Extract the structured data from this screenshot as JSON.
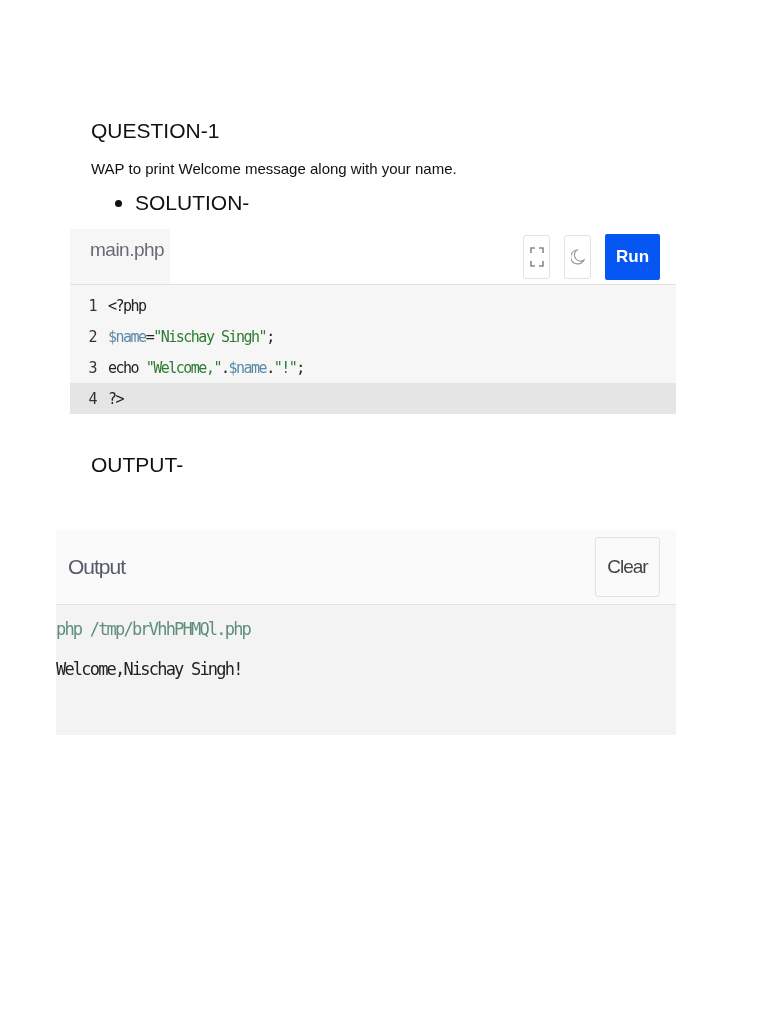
{
  "question": {
    "title": "QUESTION-1",
    "description": "WAP to print Welcome message along with your name."
  },
  "solution_label": "SOLUTION-",
  "editor": {
    "tab": "main.php",
    "run_button": "Run",
    "lines": [
      {
        "number": "1",
        "active": false,
        "tokens": [
          {
            "text": "<?php",
            "kind": "plain"
          }
        ]
      },
      {
        "number": "2",
        "active": false,
        "tokens": [
          {
            "text": "$name",
            "kind": "var"
          },
          {
            "text": "=",
            "kind": "plain"
          },
          {
            "text": "\"Nischay Singh\"",
            "kind": "string"
          },
          {
            "text": ";",
            "kind": "plain"
          }
        ]
      },
      {
        "number": "3",
        "active": false,
        "tokens": [
          {
            "text": "echo ",
            "kind": "plain"
          },
          {
            "text": "\"Welcome,\"",
            "kind": "string"
          },
          {
            "text": ".",
            "kind": "plain"
          },
          {
            "text": "$name",
            "kind": "var"
          },
          {
            "text": ".",
            "kind": "plain"
          },
          {
            "text": "\"!\"",
            "kind": "string"
          },
          {
            "text": ";",
            "kind": "plain"
          }
        ]
      },
      {
        "number": "4",
        "active": true,
        "tokens": [
          {
            "text": "?>",
            "kind": "plain"
          }
        ]
      }
    ]
  },
  "output_label": "OUTPUT-",
  "output": {
    "title": "Output",
    "clear_button": "Clear",
    "lines": [
      {
        "text": "php /tmp/brVhhPHMQl.php",
        "kind": "command"
      },
      {
        "text": "Welcome,Nischay Singh!",
        "kind": "result"
      }
    ]
  }
}
